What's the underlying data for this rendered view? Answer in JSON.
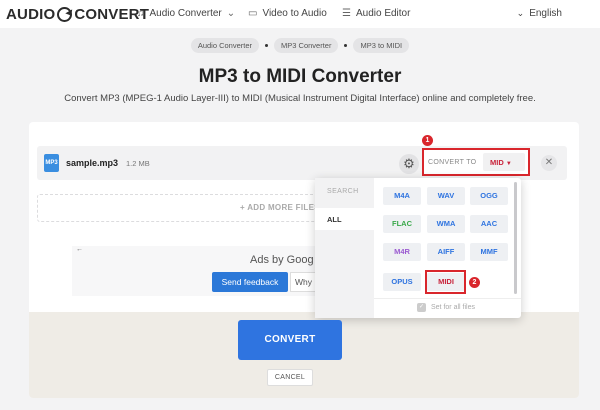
{
  "header": {
    "logo_left": "AUDIO",
    "logo_right": "CONVERT",
    "nav": [
      {
        "label": "Audio Converter",
        "icon": "music-note-icon"
      },
      {
        "label": "Video to Audio",
        "icon": "video-icon"
      },
      {
        "label": "Audio Editor",
        "icon": "sliders-icon"
      }
    ],
    "language": "English"
  },
  "breadcrumb": [
    "Audio Converter",
    "MP3 Converter",
    "MP3 to MIDI"
  ],
  "page": {
    "title": "MP3 to MIDI Converter",
    "subtitle": "Convert MP3 (MPEG-1 Audio Layer-III) to MIDI (Musical Instrument Digital Interface) online and completely free."
  },
  "file": {
    "icon_text": "MP3",
    "name": "sample.mp3",
    "size": "1.2 MB",
    "convert_to_label": "CONVERT TO",
    "selected_format": "MID"
  },
  "add_more": "ADD MORE FILES",
  "ad": {
    "label": "Ads by Goog",
    "feedback": "Send feedback",
    "why": "Why"
  },
  "dropdown": {
    "search_label": "SEARCH",
    "category": "ALL",
    "formats": [
      {
        "label": "M4A",
        "color": "#2f74e0"
      },
      {
        "label": "WAV",
        "color": "#2f74e0"
      },
      {
        "label": "OGG",
        "color": "#2f74e0"
      },
      {
        "label": "FLAC",
        "color": "#3aa84a"
      },
      {
        "label": "WMA",
        "color": "#2f74e0"
      },
      {
        "label": "AAC",
        "color": "#2f74e0"
      },
      {
        "label": "M4R",
        "color": "#9b5bd1"
      },
      {
        "label": "AIFF",
        "color": "#2f74e0"
      },
      {
        "label": "MMF",
        "color": "#2f74e0"
      },
      {
        "label": "OPUS",
        "color": "#2f74e0"
      },
      {
        "label": "MIDI",
        "color": "#c8233a"
      }
    ],
    "set_for_all": "Set for all files"
  },
  "steps": {
    "one": "1",
    "two": "2"
  },
  "actions": {
    "convert": "CONVERT",
    "cancel": "CANCEL"
  }
}
